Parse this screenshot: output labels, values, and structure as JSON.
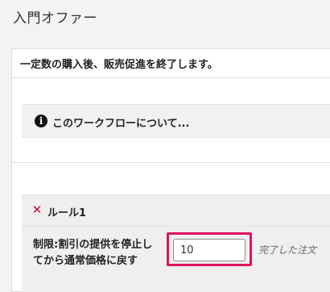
{
  "page": {
    "title": "入門オファー"
  },
  "panel": {
    "header": "一定数の購入後、販売促進を終了します。"
  },
  "info": {
    "icon": "info-icon",
    "label": "このワークフローについて..."
  },
  "rule": {
    "remove_icon": "close-icon",
    "remove_glyph": "✕",
    "title": "ルール1",
    "field_label": "制限:割引の提供を停止してから通常価格に戻す",
    "input_value": "10",
    "suffix": "完了した注文"
  },
  "colors": {
    "highlight": "#e0115f",
    "remove": "#c8102e"
  }
}
